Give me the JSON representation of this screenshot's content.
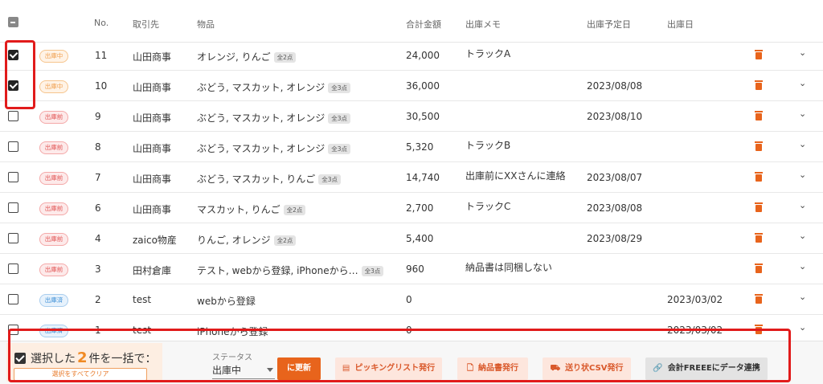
{
  "header": {
    "no": "No.",
    "partner": "取引先",
    "items": "物品",
    "total": "合計金額",
    "memo": "出庫メモ",
    "planned_date": "出庫予定日",
    "date": "出庫日"
  },
  "rows": [
    {
      "checked": true,
      "status": "出庫中",
      "status_type": "shukkochu",
      "no": "11",
      "partner": "山田商事",
      "items": "オレンジ, りんご",
      "count": "全2点",
      "total": "24,000",
      "memo": "トラックA",
      "planned": "",
      "date": ""
    },
    {
      "checked": true,
      "status": "出庫中",
      "status_type": "shukkochu",
      "no": "10",
      "partner": "山田商事",
      "items": "ぶどう, マスカット, オレンジ",
      "count": "全3点",
      "total": "36,000",
      "memo": "",
      "planned": "2023/08/08",
      "date": ""
    },
    {
      "checked": false,
      "status": "出庫前",
      "status_type": "shukkomae",
      "no": "9",
      "partner": "山田商事",
      "items": "ぶどう, マスカット, オレンジ",
      "count": "全3点",
      "total": "30,500",
      "memo": "",
      "planned": "2023/08/10",
      "date": ""
    },
    {
      "checked": false,
      "status": "出庫前",
      "status_type": "shukkomae",
      "no": "8",
      "partner": "山田商事",
      "items": "ぶどう, マスカット, オレンジ",
      "count": "全3点",
      "total": "5,320",
      "memo": "トラックB",
      "planned": "",
      "date": ""
    },
    {
      "checked": false,
      "status": "出庫前",
      "status_type": "shukkomae",
      "no": "7",
      "partner": "山田商事",
      "items": "ぶどう, マスカット, りんご",
      "count": "全3点",
      "total": "14,740",
      "memo": "出庫前にXXさんに連絡",
      "planned": "2023/08/07",
      "date": ""
    },
    {
      "checked": false,
      "status": "出庫前",
      "status_type": "shukkomae",
      "no": "6",
      "partner": "山田商事",
      "items": "マスカット, りんご",
      "count": "全2点",
      "total": "2,700",
      "memo": "トラックC",
      "planned": "2023/08/08",
      "date": ""
    },
    {
      "checked": false,
      "status": "出庫前",
      "status_type": "shukkomae",
      "no": "4",
      "partner": "zaico物産",
      "items": "りんご, オレンジ",
      "count": "全2点",
      "total": "5,400",
      "memo": "",
      "planned": "2023/08/29",
      "date": ""
    },
    {
      "checked": false,
      "status": "出庫前",
      "status_type": "shukkomae",
      "no": "3",
      "partner": "田村倉庫",
      "items": "テスト, webから登録, iPhoneから…",
      "count": "全3点",
      "total": "960",
      "memo": "納品書は同梱しない",
      "planned": "",
      "date": ""
    },
    {
      "checked": false,
      "status": "出庫済",
      "status_type": "shukkozumi",
      "no": "2",
      "partner": "test",
      "items": "webから登録",
      "count": "",
      "total": "0",
      "memo": "",
      "planned": "",
      "date": "2023/03/02"
    },
    {
      "checked": false,
      "status": "出庫済",
      "status_type": "shukkozumi",
      "no": "1",
      "partner": "test",
      "items": "iPhoneから登録",
      "count": "",
      "total": "0",
      "memo": "",
      "planned": "",
      "date": "2023/03/02"
    }
  ],
  "bulk_bar": {
    "selected_prefix": "選択した",
    "selected_count": "2",
    "selected_suffix": "件を一括で：",
    "clear_label": "選択をすべてクリア",
    "status_label": "ステータス",
    "status_value": "出庫中",
    "update_label": "に更新",
    "picking_label": "ピッキングリスト発行",
    "invoice_label": "納品書発行",
    "shipping_csv_label": "送り状CSV発行",
    "freee_label": "会計FREEEにデータ連携"
  },
  "colors": {
    "accent": "#e8641c",
    "highlight": "#e11b1b"
  }
}
